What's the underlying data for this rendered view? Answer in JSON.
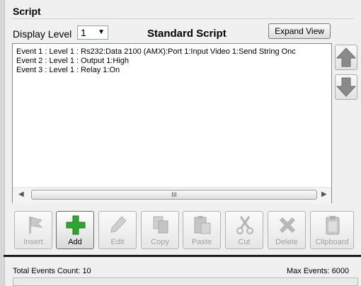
{
  "panel": {
    "title": "Script"
  },
  "display_level": {
    "label": "Display Level",
    "value": "1"
  },
  "script_title": "Standard Script",
  "expand_button": "Expand View",
  "events": [
    "Event 1 : Level 1 : Rs232:Data 2100 (AMX):Port 1:Input Video 1:Send String Onc",
    "Event 2 : Level 1 : Output 1:High",
    "Event 3 : Level 1 : Relay 1:On"
  ],
  "scrollbar": {
    "thumb_grip": "III"
  },
  "toolbar": {
    "insert": "Insert",
    "add": "Add",
    "edit": "Edit",
    "copy": "Copy",
    "paste": "Paste",
    "cut": "Cut",
    "delete": "Delete",
    "clipboard": "Clipboard"
  },
  "status": {
    "total": "Total Events Count: 10",
    "max": "Max Events: 6000"
  },
  "colors": {
    "add_green": "#2fa52f",
    "arrow_gray": "#8a8a8a",
    "disabled_text": "#a0a0a0"
  },
  "icons": {
    "move_up": "arrow-up-icon",
    "move_down": "arrow-down-icon",
    "insert": "insert-flag-icon",
    "add": "plus-icon",
    "edit": "pencil-icon",
    "copy": "copy-icon",
    "paste": "paste-icon",
    "cut": "scissors-icon",
    "delete": "x-icon",
    "clipboard": "clipboard-icon"
  }
}
